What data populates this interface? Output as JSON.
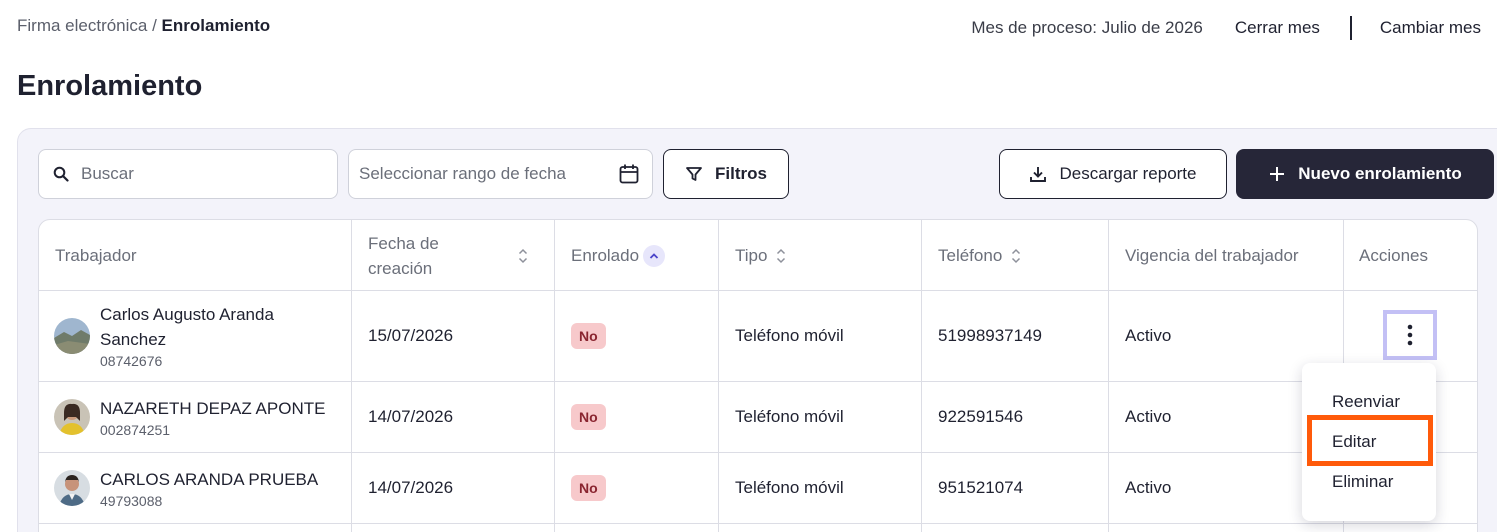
{
  "breadcrumb": {
    "parent": "Firma electrónica",
    "separator": " / ",
    "current": "Enrolamiento"
  },
  "header": {
    "process_month": "Mes de proceso: Julio de 2026",
    "close_month": "Cerrar mes",
    "change_month": "Cambiar mes"
  },
  "page": {
    "title": "Enrolamiento"
  },
  "toolbar": {
    "search_placeholder": "Buscar",
    "date_placeholder": "Seleccionar rango de fecha",
    "filters_label": "Filtros",
    "download_label": "Descargar reporte",
    "new_label": "Nuevo enrolamiento"
  },
  "table": {
    "headers": {
      "worker": "Trabajador",
      "created_line1": "Fecha de",
      "created_line2": "creación",
      "enrolled": "Enrolado",
      "type": "Tipo",
      "phone": "Teléfono",
      "validity": "Vigencia del trabajador",
      "actions": "Acciones"
    },
    "rows": [
      {
        "name_line1": "Carlos Augusto Aranda",
        "name_line2": "Sanchez",
        "id": "08742676",
        "created": "15/07/2026",
        "enrolled": "No",
        "type": "Teléfono móvil",
        "phone": "51998937149",
        "validity": "Activo"
      },
      {
        "name_line1": "NAZARETH DEPAZ APONTE",
        "id": "002874251",
        "created": "14/07/2026",
        "enrolled": "No",
        "type": "Teléfono móvil",
        "phone": "922591546",
        "validity": "Activo"
      },
      {
        "name_line1": "CARLOS ARANDA PRUEBA",
        "id": "49793088",
        "created": "14/07/2026",
        "enrolled": "No",
        "type": "Teléfono móvil",
        "phone": "951521074",
        "validity": "Activo"
      }
    ]
  },
  "actions_menu": {
    "resend": "Reenviar",
    "edit": "Editar",
    "delete": "Eliminar"
  },
  "colors": {
    "primary_dark": "#262638",
    "badge_bg": "#f7c9cb",
    "highlight_orange": "#ff5a0a",
    "focus_purple": "#c3c0f5"
  }
}
